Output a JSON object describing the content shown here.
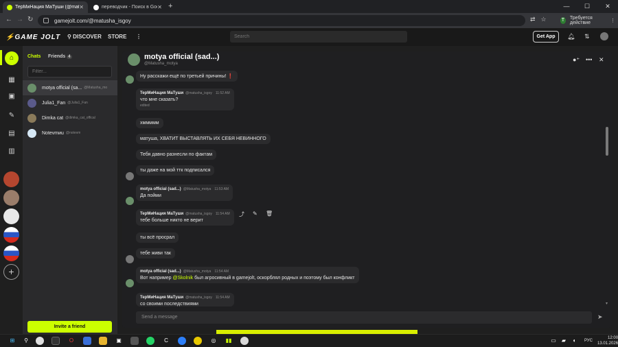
{
  "browser": {
    "tabs": [
      {
        "title": "ТерМиНация МаТуши (@matusha_",
        "active": true
      },
      {
        "title": "переводчик - Поиск в Google",
        "active": false
      }
    ],
    "url": "gamejolt.com/@matusha_isgoy",
    "required_action": "Требуется действие"
  },
  "gamejolt_header": {
    "logo": "GAME JOLT",
    "discover": "DISCOVER",
    "store": "STORE",
    "search_placeholder": "Search",
    "get_app": "Get App"
  },
  "chat_panel": {
    "tab_chats": "Chats",
    "tab_friends": "Friends",
    "friends_count": "4",
    "filter_placeholder": "Filter...",
    "items": [
      {
        "name": "motya official (sa...",
        "username": "@Matusha_mo"
      },
      {
        "name": "Julia1_Fan",
        "username": "@Julia1_Fan"
      },
      {
        "name": "Dimka cat",
        "username": "@dimka_cat_offical"
      },
      {
        "name": "Notevmиu",
        "username": "@notevm"
      }
    ],
    "invite": "Invite a friend"
  },
  "chat": {
    "title": "motya official (sad...)",
    "username": "@Matusha_motya",
    "messages": [
      {
        "text": "Ну расскажи ещё по третьей причины!"
      },
      {
        "author": "ТерМиНация МаТуши",
        "handle": "@matusha_isgoy",
        "time": "11:52 AM",
        "text": "что мне сказать?",
        "edited": "edited"
      },
      {
        "text": "хммммм"
      },
      {
        "text": "матуша, ХВАТИТ ВЫСТАВЛЯТЬ ИХ СЕБЯ НЕВИННОГО"
      },
      {
        "text": "Тебя давно разнесли по фактам"
      },
      {
        "text": "ты даже на мой ттк подписался"
      },
      {
        "author": "motya official (sad...)",
        "handle": "@Matusha_motya",
        "time": "11:53 AM",
        "text": "Да пойми"
      },
      {
        "author": "ТерМиНация МаТуши",
        "handle": "@matusha_isgoy",
        "time": "11:54 AM",
        "text": "тебе больше никто не верит"
      },
      {
        "text": "ты всё просрал"
      },
      {
        "text": "тебе живи так"
      },
      {
        "author": "motya official (sad...)",
        "handle": "@Matusha_motya",
        "time": "11:54 AM",
        "text_before": "Вот например ",
        "mention": "@Skolnik",
        "text_after": " был агросивный в gamejolt, оскорблял родных и поэтому был конфликт"
      },
      {
        "author": "ТерМиНация МаТуши",
        "handle": "@matusha_isgoy",
        "time": "11:54 AM",
        "text": "со своими последствиями"
      }
    ],
    "composer_placeholder": "Send a message"
  },
  "taskbar": {
    "lang": "РУС",
    "time": "12:00",
    "date": "13.01.2026"
  },
  "colors": {
    "accent": "#ccff00",
    "panel": "#2a2a2c",
    "bubble": "#2b2b2d",
    "background": "#1f1f21"
  }
}
